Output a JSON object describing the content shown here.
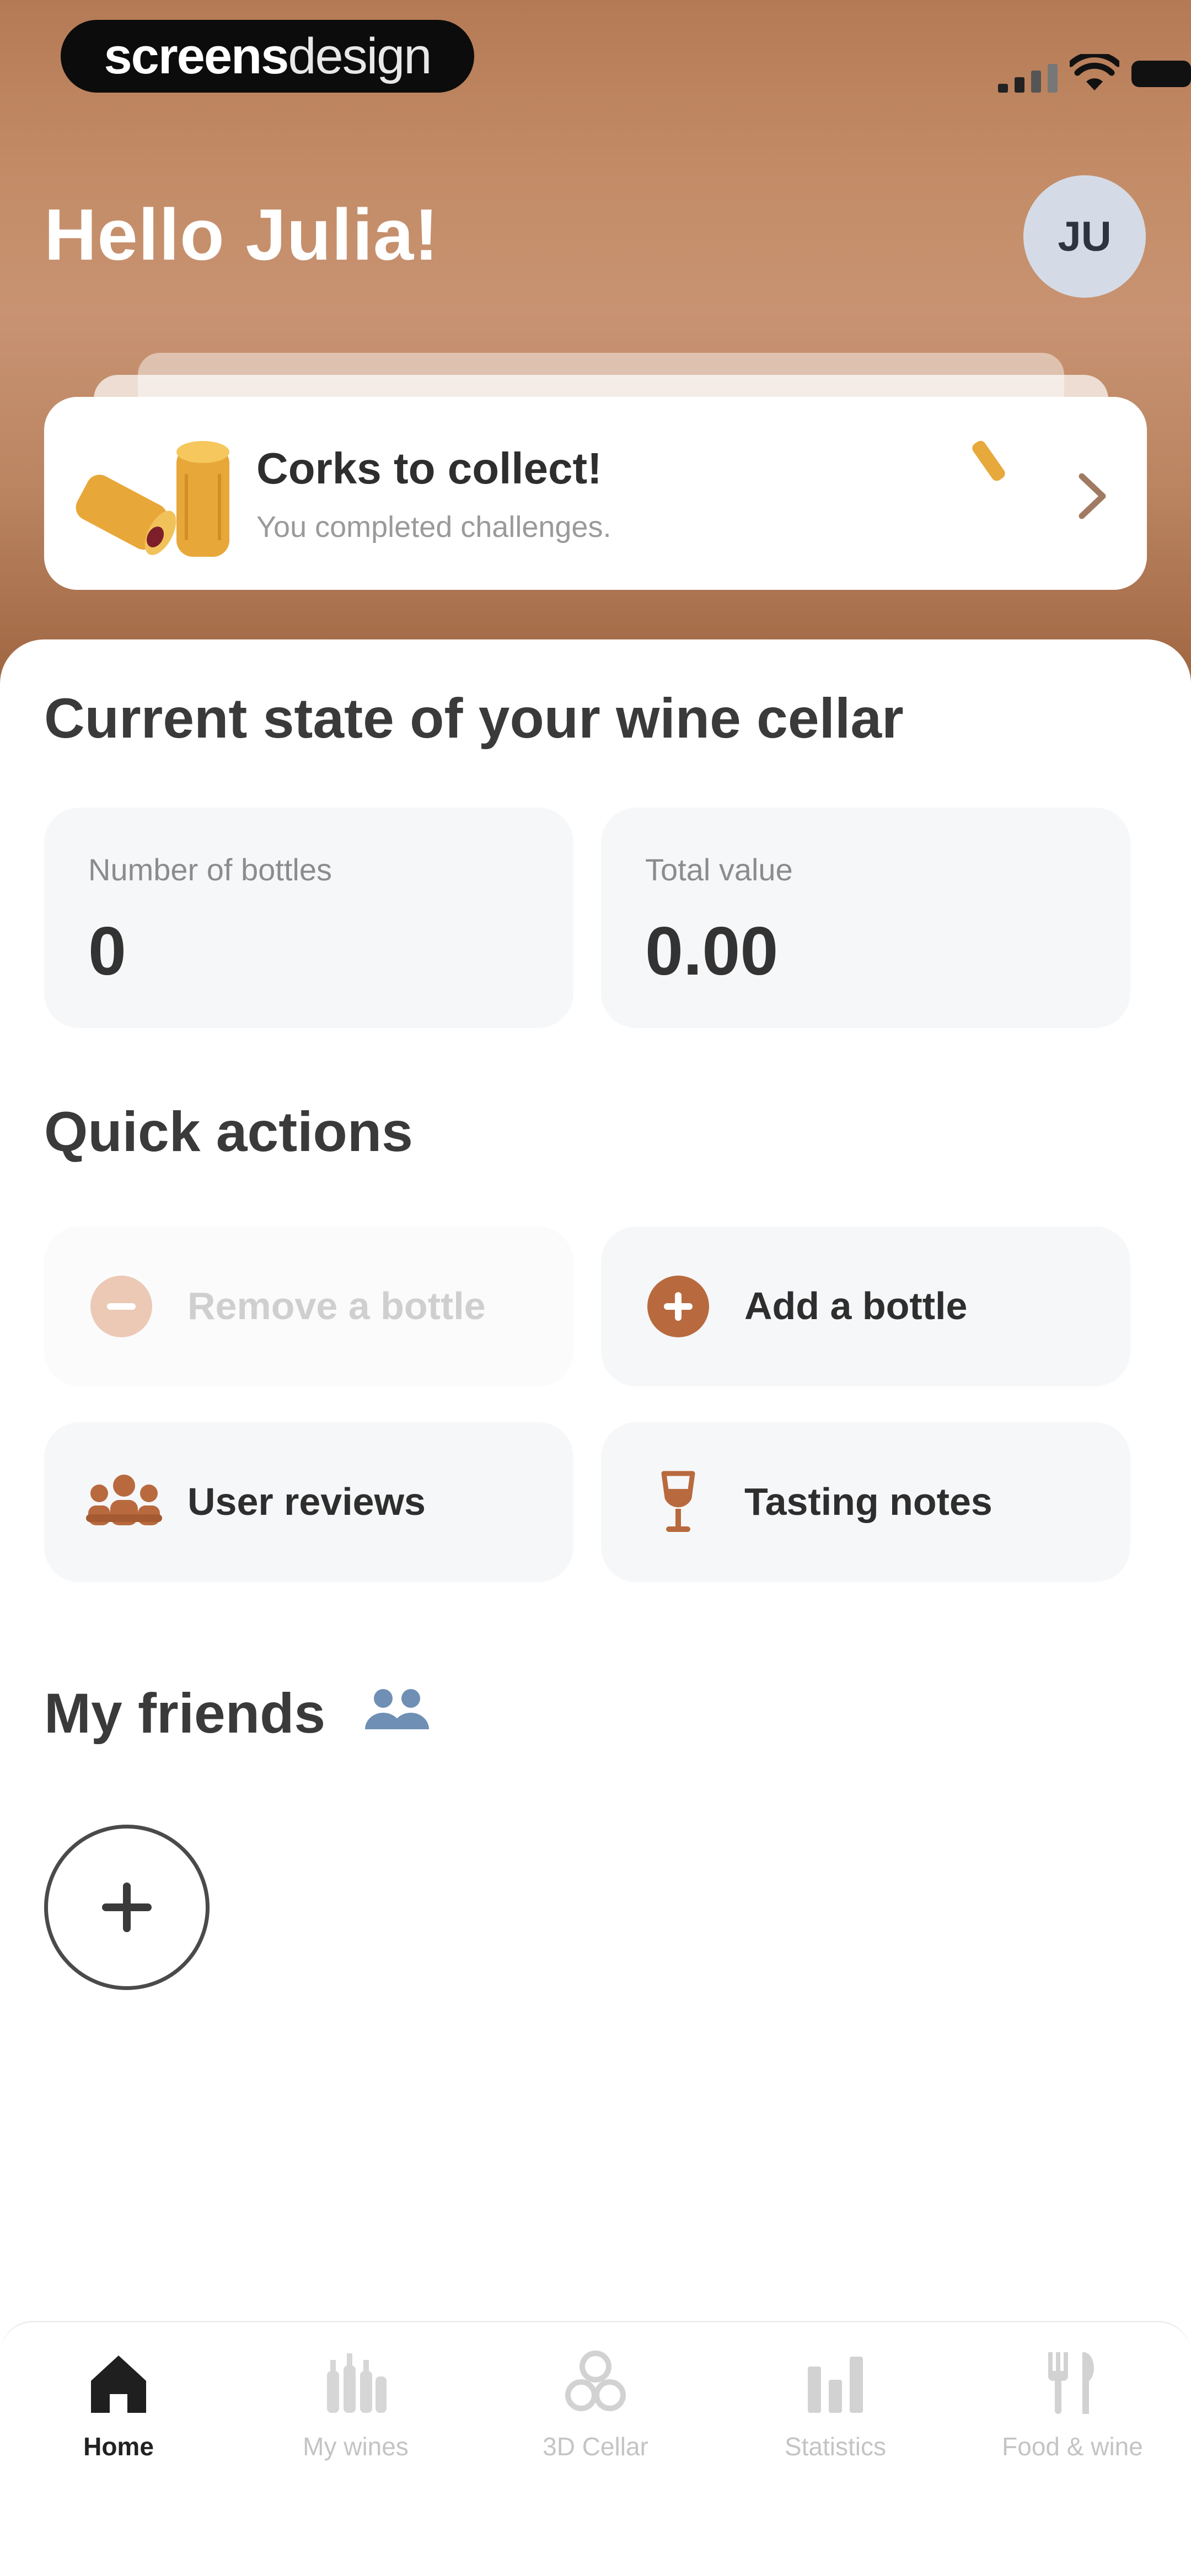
{
  "status_bar": {
    "brand_bold": "screens",
    "brand_light": "design"
  },
  "header": {
    "greeting": "Hello Julia!",
    "avatar_initials": "JU"
  },
  "challenge_card": {
    "title": "Corks to collect!",
    "subtitle": "You completed challenges."
  },
  "cellar": {
    "title": "Current state of your wine cellar",
    "bottles_label": "Number of bottles",
    "bottles_value": "0",
    "value_label": "Total value",
    "value_value": "0.00"
  },
  "quick_actions": {
    "title": "Quick actions",
    "remove": "Remove a bottle",
    "add": "Add a bottle",
    "reviews": "User reviews",
    "tasting": "Tasting notes"
  },
  "friends": {
    "title": "My friends"
  },
  "tabs": [
    {
      "label": "Home",
      "icon": "home-icon",
      "active": true
    },
    {
      "label": "My wines",
      "icon": "bottles-icon"
    },
    {
      "label": "3D Cellar",
      "icon": "cellar-icon"
    },
    {
      "label": "Statistics",
      "icon": "statistics-icon"
    },
    {
      "label": "Food & wine",
      "icon": "cutlery-icon"
    }
  ],
  "colors": {
    "accent": "#b86a3e",
    "header_gradient_top": "#b47a55",
    "header_gradient_bottom": "#9e6440"
  }
}
